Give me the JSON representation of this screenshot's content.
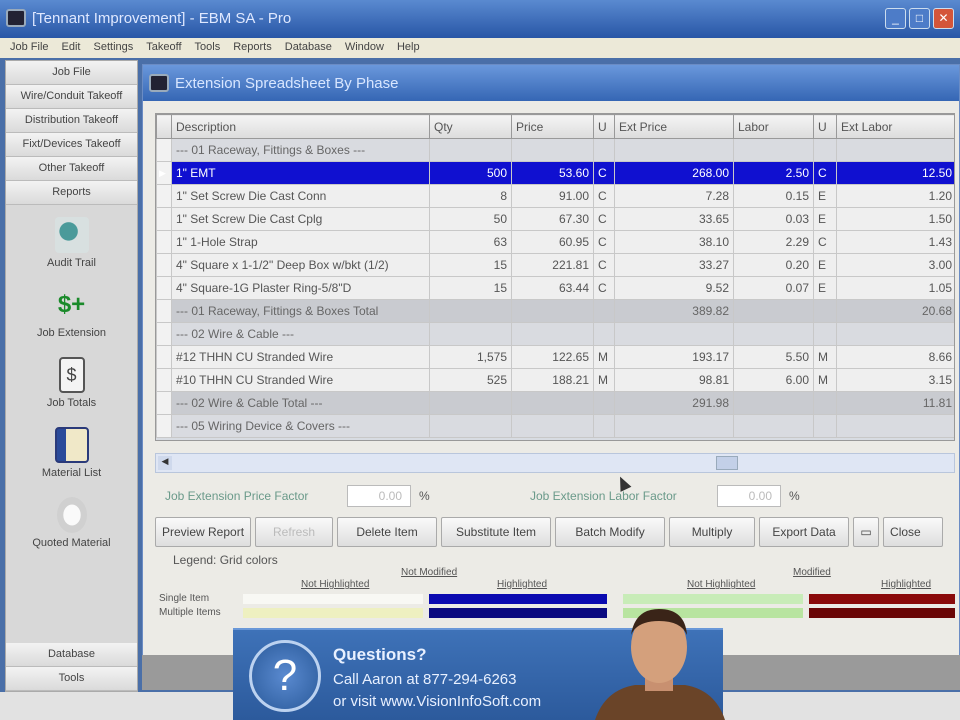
{
  "app": {
    "title": "[Tennant Improvement] - EBM SA - Pro"
  },
  "menu": [
    "Job File",
    "Edit",
    "Settings",
    "Takeoff",
    "Tools",
    "Reports",
    "Database",
    "Window",
    "Help"
  ],
  "sidebar": {
    "top": [
      "Job File",
      "Wire/Conduit Takeoff",
      "Distribution Takeoff",
      "Fixt/Devices Takeoff",
      "Other Takeoff",
      "Reports"
    ],
    "icons": [
      {
        "label": "Audit Trail",
        "icon": "magnifier-icon"
      },
      {
        "label": "Job Extension",
        "icon": "dollar-plus-icon"
      },
      {
        "label": "Job Totals",
        "icon": "dollar-document-icon"
      },
      {
        "label": "Material List",
        "icon": "material-list-icon"
      },
      {
        "label": "Quoted Material",
        "icon": "quote-icon"
      }
    ],
    "bottom": [
      "Database",
      "Tools"
    ]
  },
  "window": {
    "title": "Extension Spreadsheet By Phase"
  },
  "grid": {
    "columns": [
      "Description",
      "Qty",
      "Price",
      "U",
      "Ext Price",
      "Labor",
      "U",
      "Ext Labor"
    ],
    "rows": [
      {
        "type": "group",
        "cells": [
          "--- 01 Raceway, Fittings & Boxes ---",
          "",
          "",
          "",
          "",
          "",
          "",
          ""
        ]
      },
      {
        "type": "sel",
        "cells": [
          "1\" EMT",
          "500",
          "53.60",
          "C",
          "268.00",
          "2.50",
          "C",
          "12.50"
        ]
      },
      {
        "type": "item",
        "cells": [
          "1\" Set Screw Die Cast Conn",
          "8",
          "91.00",
          "C",
          "7.28",
          "0.15",
          "E",
          "1.20"
        ]
      },
      {
        "type": "item",
        "cells": [
          "1\" Set Screw Die Cast Cplg",
          "50",
          "67.30",
          "C",
          "33.65",
          "0.03",
          "E",
          "1.50"
        ]
      },
      {
        "type": "item",
        "cells": [
          "1\" 1-Hole Strap",
          "63",
          "60.95",
          "C",
          "38.10",
          "2.29",
          "C",
          "1.43"
        ]
      },
      {
        "type": "item",
        "cells": [
          "4\" Square x 1-1/2\" Deep Box w/bkt (1/2)",
          "15",
          "221.81",
          "C",
          "33.27",
          "0.20",
          "E",
          "3.00"
        ]
      },
      {
        "type": "item",
        "cells": [
          "4\" Square-1G Plaster Ring-5/8\"D",
          "15",
          "63.44",
          "C",
          "9.52",
          "0.07",
          "E",
          "1.05"
        ]
      },
      {
        "type": "total",
        "cells": [
          "--- 01 Raceway, Fittings & Boxes Total",
          "",
          "",
          "",
          "389.82",
          "",
          "",
          "20.68"
        ]
      },
      {
        "type": "group",
        "cells": [
          "--- 02 Wire & Cable ---",
          "",
          "",
          "",
          "",
          "",
          "",
          ""
        ]
      },
      {
        "type": "item",
        "cells": [
          "#12 THHN CU Stranded Wire",
          "1,575",
          "122.65",
          "M",
          "193.17",
          "5.50",
          "M",
          "8.66"
        ]
      },
      {
        "type": "item",
        "cells": [
          "#10 THHN CU Stranded Wire",
          "525",
          "188.21",
          "M",
          "98.81",
          "6.00",
          "M",
          "3.15"
        ]
      },
      {
        "type": "total",
        "cells": [
          "--- 02 Wire & Cable Total ---",
          "",
          "",
          "",
          "291.98",
          "",
          "",
          "11.81"
        ]
      },
      {
        "type": "group",
        "cells": [
          "--- 05 Wiring Device & Covers ---",
          "",
          "",
          "",
          "",
          "",
          "",
          ""
        ]
      }
    ]
  },
  "factors": {
    "price_label": "Job Extension Price Factor",
    "price_value": "0.00",
    "labor_label": "Job Extension Labor Factor",
    "labor_value": "0.00",
    "pct": "%"
  },
  "buttons": [
    "Preview Report",
    "Refresh",
    "Delete Item",
    "Substitute Item",
    "Batch Modify",
    "Multiply",
    "Export Data",
    "Close"
  ],
  "legend": {
    "title": "Legend: Grid colors",
    "not_modified": "Not Modified",
    "modified": "Modified",
    "not_highlighted": "Not Highlighted",
    "highlighted": "Highlighted",
    "single": "Single Item",
    "multiple": "Multiple Items",
    "colors": {
      "single_nm_nh": "#f8f8f4",
      "single_nm_h": "#0a0ab0",
      "single_m_nh": "#c8ecb8",
      "single_m_h": "#8a0a0a",
      "multi_nm_nh": "#eef0c0",
      "multi_nm_h": "#0a0a80",
      "multi_m_nh": "#b8e4a0",
      "multi_m_h": "#6a0606"
    }
  },
  "ad": {
    "heading": "Questions?",
    "line1": "Call Aaron at 877-294-6263",
    "line2": "or visit www.VisionInfoSoft.com"
  }
}
